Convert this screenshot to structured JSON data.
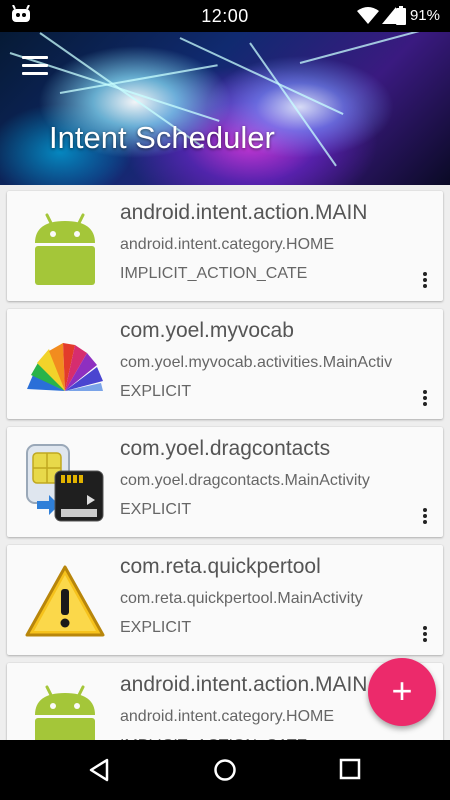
{
  "status_bar": {
    "time": "12:00",
    "battery": "91%"
  },
  "header": {
    "title": "Intent Scheduler"
  },
  "intents": [
    {
      "title": "android.intent.action.MAIN",
      "subtitle": "android.intent.category.HOME",
      "type": "IMPLICIT_ACTION_CATE",
      "icon": "android-robot-icon"
    },
    {
      "title": "com.yoel.myvocab",
      "subtitle": "com.yoel.myvocab.activities.MainActiv",
      "type": "EXPLICIT",
      "icon": "myvocab-book-icon"
    },
    {
      "title": "com.yoel.dragcontacts",
      "subtitle": "com.yoel.dragcontacts.MainActivity",
      "type": "EXPLICIT",
      "icon": "sim-sd-card-icon"
    },
    {
      "title": "com.reta.quickpertool",
      "subtitle": "com.reta.quickpertool.MainActivity",
      "type": "EXPLICIT",
      "icon": "warning-triangle-icon"
    },
    {
      "title": "android.intent.action.MAIN",
      "subtitle": "android.intent.category.HOME",
      "type": "IMPLICIT_ACTION_CATE",
      "icon": "android-robot-icon"
    }
  ],
  "fab": {
    "label": "+"
  },
  "colors": {
    "accent": "#ec2a6b",
    "status_bar": "#000000",
    "card": "#fafafa",
    "background": "#eeeeee"
  }
}
